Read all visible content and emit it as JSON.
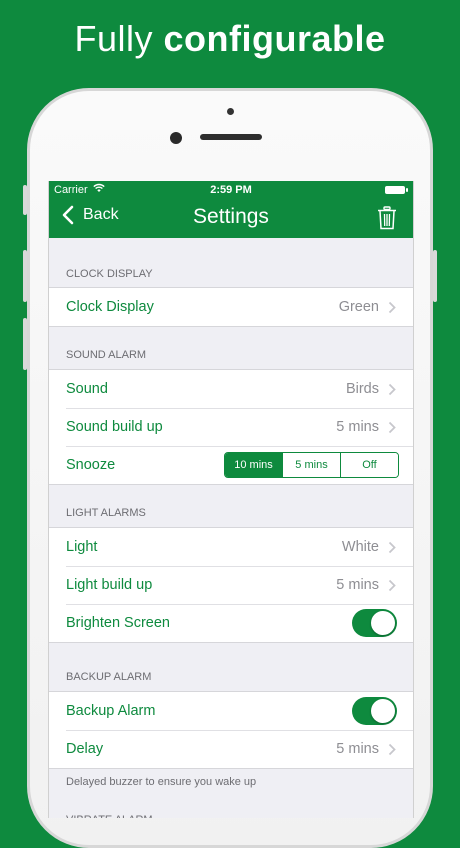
{
  "headline": {
    "light": "Fully ",
    "bold": "configurable"
  },
  "status": {
    "carrier": "Carrier",
    "time": "2:59 PM"
  },
  "nav": {
    "back_label": "Back",
    "title": "Settings"
  },
  "sections": {
    "clock": {
      "header": "CLOCK DISPLAY",
      "rows": [
        {
          "label": "Clock Display",
          "value": "Green"
        }
      ]
    },
    "sound": {
      "header": "SOUND ALARM",
      "rows": [
        {
          "label": "Sound",
          "value": "Birds"
        },
        {
          "label": "Sound build up",
          "value": "5 mins"
        },
        {
          "label": "Snooze",
          "options": [
            "10 mins",
            "5 mins",
            "Off"
          ],
          "selected": "10 mins"
        }
      ]
    },
    "light": {
      "header": "LIGHT ALARMS",
      "rows": [
        {
          "label": "Light",
          "value": "White"
        },
        {
          "label": "Light build up",
          "value": "5 mins"
        },
        {
          "label": "Brighten Screen",
          "toggle": true
        }
      ]
    },
    "backup": {
      "header": "BACKUP ALARM",
      "rows": [
        {
          "label": "Backup Alarm",
          "toggle": true
        },
        {
          "label": "Delay",
          "value": "5 mins"
        }
      ],
      "footer": "Delayed buzzer to ensure you wake up"
    },
    "vibrate": {
      "header": "VIBRATE ALARM"
    }
  },
  "colors": {
    "accent": "#0e8a3e",
    "background": "#efeff4",
    "secondary_text": "#8e8e93"
  },
  "icons": {
    "back": "chevron-left-icon",
    "trash": "trash-icon",
    "disclosure": "chevron-right-icon",
    "wifi": "wifi-icon",
    "battery": "battery-icon"
  }
}
